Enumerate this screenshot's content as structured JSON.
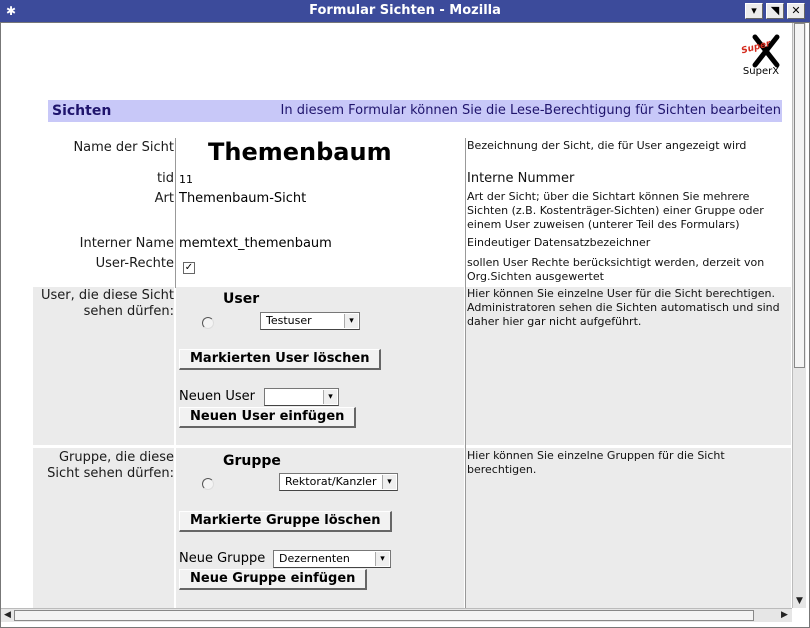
{
  "window": {
    "title": "Formular Sichten - Mozilla",
    "menu_glyph": "✱",
    "minimize_glyph": "▾",
    "maximize_glyph": "◥",
    "close_glyph": "✕"
  },
  "logo": {
    "label": "SuperX",
    "mark": "Super"
  },
  "header": {
    "left": "Sichten",
    "right": "In diesem Formular können Sie die Lese-Berechtigung für Sichten bearbeiten"
  },
  "fields": {
    "name": {
      "label": "Name der Sicht",
      "value": "Themenbaum",
      "desc": "Bezeichnung der Sicht, die für User angezeigt wird"
    },
    "tid": {
      "label": "tid",
      "value": "11",
      "desc": "Interne Nummer"
    },
    "art": {
      "label": "Art",
      "value": "Themenbaum-Sicht",
      "desc": "Art der Sicht; über die Sichtart können Sie mehrere Sichten (z.B. Kostenträger-Sichten) einer Gruppe oder einem User zuweisen (unterer Teil des Formulars)"
    },
    "internal": {
      "label": "Interner Name",
      "value": "memtext_themenbaum",
      "desc": "Eindeutiger Datensatzbezeichner"
    },
    "rights": {
      "label": "User-Rechte",
      "checked": "✓",
      "desc": "sollen User Rechte berücksichtigt werden, derzeit von Org.Sichten ausgewertet"
    }
  },
  "users": {
    "label_line1": "User, die diese Sicht",
    "label_line2": "sehen dürfen:",
    "heading": "User",
    "selected": "Testuser",
    "delete_button": "Markierten User löschen",
    "new_label": "Neuen User",
    "new_value": "",
    "add_button": "Neuen User einfügen",
    "desc": "Hier können Sie einzelne User für die Sicht berechtigen. Administratoren sehen die Sichten automatisch und sind daher hier gar nicht aufgeführt."
  },
  "groups": {
    "label_line1": "Gruppe, die diese",
    "label_line2": "Sicht sehen dürfen:",
    "heading": "Gruppe",
    "selected": "Rektorat/Kanzler",
    "delete_button": "Markierte Gruppe löschen",
    "new_label": "Neue Gruppe",
    "new_value": "Dezernenten",
    "add_button": "Neue Gruppe einfügen",
    "desc": "Hier können Sie einzelne Gruppen für die Sicht berechtigen."
  },
  "icons": {
    "dropdown": "▾",
    "scroll_up": "▲",
    "scroll_down": "▼",
    "scroll_left": "◀",
    "scroll_right": "▶"
  },
  "colors": {
    "titlebar": "#3c4b9b",
    "header_bg": "#c8c8f8",
    "header_text": "#1f146c",
    "section_bg": "#ebebeb",
    "logo_red": "#d42a1c"
  }
}
